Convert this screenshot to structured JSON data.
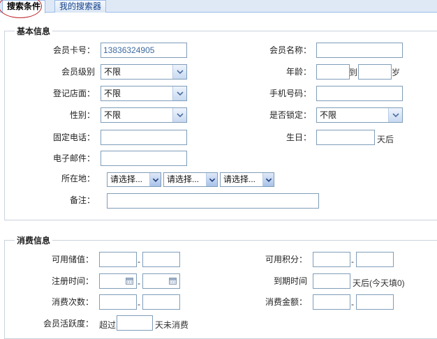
{
  "tabs": [
    {
      "label": "搜索条件",
      "active": true
    },
    {
      "label": "我的搜索器",
      "active": false
    }
  ],
  "basic": {
    "legend": "基本信息",
    "card_no": {
      "label": "会员卡号：",
      "value": "13836324905"
    },
    "member_name": {
      "label": "会员名称："
    },
    "level": {
      "label": "会员级别",
      "selected": "不限"
    },
    "age": {
      "label": "年龄：",
      "to": "到",
      "unit": "岁"
    },
    "store": {
      "label": "登记店面：",
      "selected": "不限"
    },
    "mobile": {
      "label": "手机号码："
    },
    "gender": {
      "label": "性别：",
      "selected": "不限"
    },
    "locked": {
      "label": "是否锁定：",
      "selected": "不限"
    },
    "phone": {
      "label": "固定电话："
    },
    "birthday": {
      "label": "生日：",
      "suffix": "天后"
    },
    "email": {
      "label": "电子邮件："
    },
    "location": {
      "label": "所在地：",
      "selects": [
        "请选择...",
        "请选择...",
        "请选择..."
      ]
    },
    "remark": {
      "label": "备注："
    }
  },
  "consume": {
    "legend": "消费信息",
    "balance": {
      "label": "可用储值："
    },
    "points": {
      "label": "可用积分："
    },
    "reg_time": {
      "label": "注册时间："
    },
    "expire": {
      "label": "到期时间",
      "suffix": "天后(今天填0)"
    },
    "count": {
      "label": "消费次数："
    },
    "amount": {
      "label": "消费金额："
    },
    "activity": {
      "label": "会员活跃度：",
      "prefix": "超过",
      "suffix": "天未消费"
    },
    "dash": "-"
  },
  "icons": {
    "dropdown": "chevron-down-icon",
    "calendar": "calendar-icon"
  },
  "colors": {
    "tab_bg": "#dfe9f6",
    "border": "#7f9db9",
    "circle": "#c0262b",
    "card_text": "#3d6aa0"
  }
}
